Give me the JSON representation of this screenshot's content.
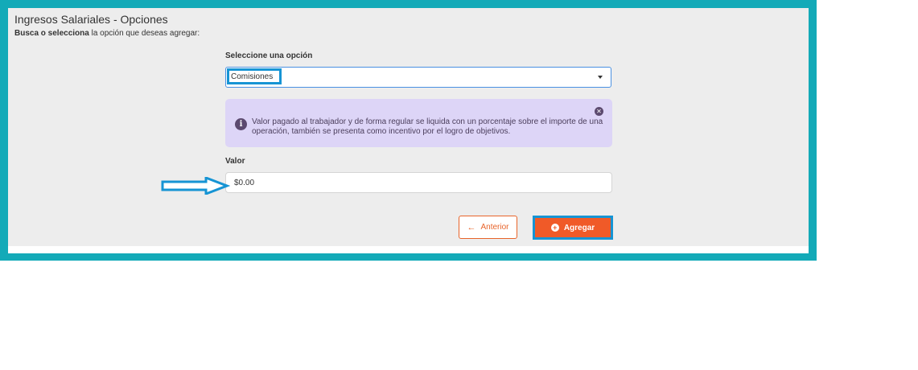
{
  "header": {
    "title": "Ingresos Salariales - Opciones",
    "subtitle_bold": "Busca o selecciona",
    "subtitle_rest": " la opción que deseas agregar:"
  },
  "select": {
    "label": "Seleccione una opción",
    "value": "Comisiones"
  },
  "info": {
    "icon": "info-icon",
    "text": "Valor pagado al trabajador y de forma regular se liquida con un porcentaje sobre el importe de una operación, también se presenta como incentivo por el logro de objetivos."
  },
  "amount": {
    "label": "Valor",
    "value": "$0.00"
  },
  "buttons": {
    "previous_label": "Anterior",
    "add_label": "Agregar"
  },
  "colors": {
    "frame": "#13aab8",
    "accent_orange": "#f05a28",
    "highlight_blue": "#1694d4",
    "info_background": "#ddd5f7"
  }
}
